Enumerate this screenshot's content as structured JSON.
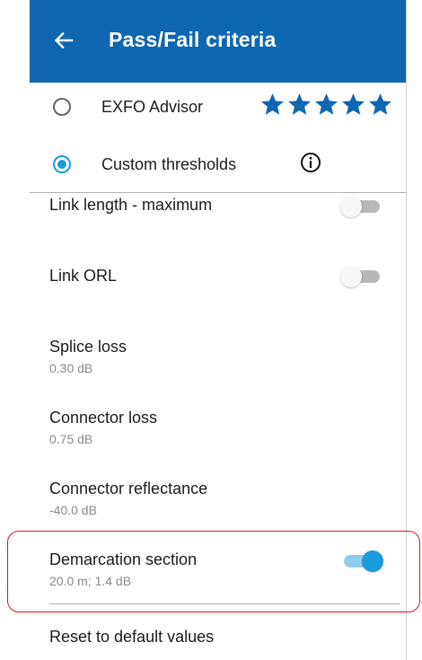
{
  "header": {
    "title": "Pass/Fail criteria",
    "back_icon": "arrow-left-icon",
    "background_color": "#0f67b1"
  },
  "options": {
    "exfo_advisor": {
      "label": "EXFO Advisor",
      "selected": false,
      "rating_stars": 5,
      "star_color": "#0f67b1"
    },
    "custom_thresholds": {
      "label": "Custom thresholds",
      "selected": true,
      "info_icon": "info-circle-icon"
    }
  },
  "settings": {
    "link_length": {
      "title": "Link length - maximum",
      "enabled": false
    },
    "link_orl": {
      "title": "Link ORL",
      "enabled": false
    },
    "splice_loss": {
      "title": "Splice loss",
      "value": "0.30 dB"
    },
    "connector_loss": {
      "title": "Connector loss",
      "value": "0.75 dB"
    },
    "connector_reflectance": {
      "title": "Connector reflectance",
      "value": "-40.0 dB"
    },
    "demarcation_section": {
      "title": "Demarcation section",
      "value": "20.0 m; 1.4 dB",
      "enabled": true
    }
  },
  "reset": {
    "label": "Reset to default values"
  },
  "colors": {
    "accent": "#1a9bdc",
    "highlight_outline": "#e0151c"
  }
}
